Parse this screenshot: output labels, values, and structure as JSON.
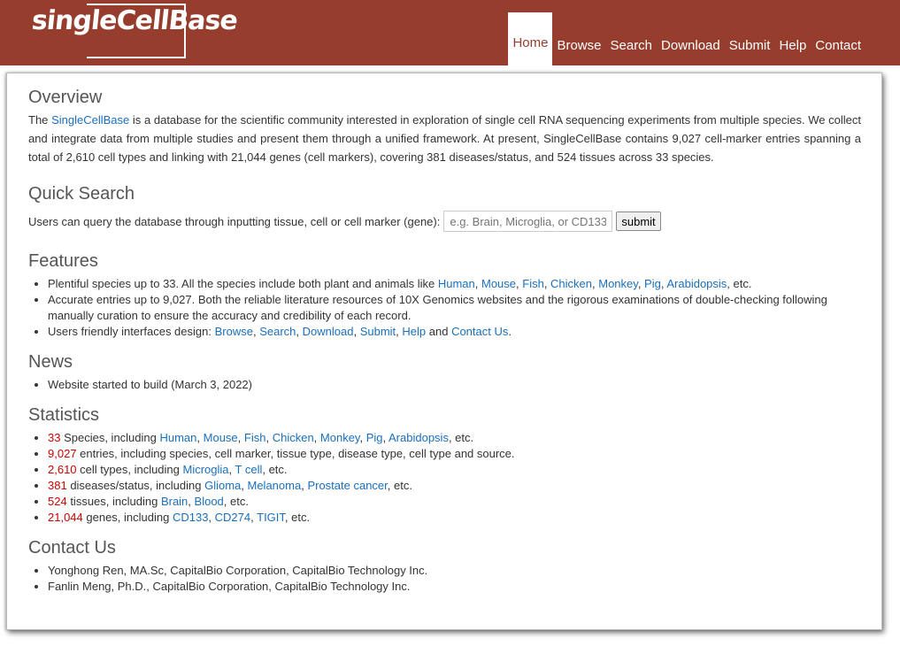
{
  "header": {
    "logo_text": "singleCellBase",
    "nav": [
      "Home",
      "Browse",
      "Search",
      "Download",
      "Submit",
      "Help",
      "Contact"
    ],
    "active": "Home"
  },
  "overview": {
    "title": "Overview",
    "pre": "The ",
    "link": "SingleCellBase",
    "text": " is a database for the scientific community interested in exploration of single cell RNA sequencing experiments from multiple species. We collect and integrate data from multiple studies and present them through a unified framework. At present, SingleCellBase contains 9,027 cell-marker entries spanning a total of 2,610 cell types and linking with 21,044 genes (cell markers), covering 381 diseases/status, and 524 tissues across 33 species."
  },
  "quick_search": {
    "title": "Quick Search",
    "label": "Users can query the database through inputting tissue, cell or cell marker (gene):",
    "placeholder": "e.g. Brain, Microglia, or CD133",
    "button": "submit"
  },
  "features": {
    "title": "Features",
    "f1_text": "Plentiful species up to 33. All the species include both plant and animals like ",
    "f1_links": [
      "Human",
      "Mouse",
      "Fish",
      "Chicken",
      "Monkey",
      "Pig",
      "Arabidopsis"
    ],
    "f1_tail": ", etc.",
    "f2_text": "Accurate entries up to 9,027. Both the reliable literature resources of 10X Genomics websites and the rigorous examinations of double-checking following manually curation to ensure the accuracy and credibility of each record.",
    "f3_text": "Users friendly interfaces design: ",
    "f3_links": [
      "Browse",
      "Search",
      "Download",
      "Submit",
      "Help"
    ],
    "f3_and": " and ",
    "f3_last": "Contact Us",
    "f3_tail": "."
  },
  "news": {
    "title": "News",
    "items": [
      "Website started to build (March 3, 2022)"
    ]
  },
  "statistics": {
    "title": "Statistics",
    "s1_num": "33",
    "s1_text": " Species, including ",
    "s1_links": [
      "Human",
      "Mouse",
      "Fish",
      "Chicken",
      "Monkey",
      "Pig",
      "Arabidopsis"
    ],
    "s2_num": "9,027",
    "s2_text": " entries, including species, cell marker, tissue type, disease type, cell type and source.",
    "s3_num": "2,610",
    "s3_text": " cell types, including ",
    "s3_links": [
      "Microglia",
      "T cell"
    ],
    "s4_num": "381",
    "s4_text": " diseases/status, including ",
    "s4_links": [
      "Glioma",
      "Melanoma",
      "Prostate cancer"
    ],
    "s5_num": "524",
    "s5_text": " tissues, including ",
    "s5_links": [
      "Brain",
      "Blood"
    ],
    "s6_num": "21,044",
    "s6_text": " genes, including ",
    "s6_links": [
      "CD133",
      "CD274",
      "TIGIT"
    ],
    "etc": ", etc.",
    "sep": ", "
  },
  "contact": {
    "title": "Contact Us",
    "items": [
      "Yonghong Ren, MA.Sc, CapitalBio Corporation, CapitalBio Technology Inc.",
      "Fanlin Meng, Ph.D., CapitalBio Corporation, CapitalBio Technology Inc."
    ]
  }
}
